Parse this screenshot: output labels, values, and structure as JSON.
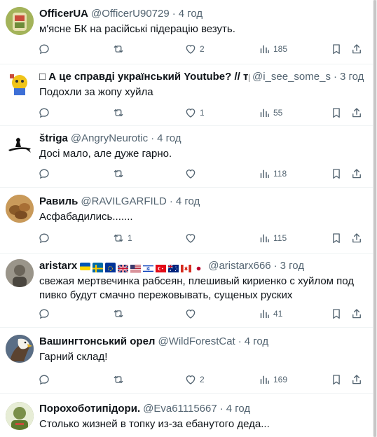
{
  "tweets": [
    {
      "name": "OfficerUA",
      "handle": "@OfficerU90729",
      "time": "4 год",
      "text": "м'ясне БК на расійські підерацію везуть.",
      "reply_count": "",
      "retweet_count": "",
      "like_count": "2",
      "view_count": "185",
      "avatar_color": "#a3b35a"
    },
    {
      "name": "А це справді український Youtube? // тре",
      "handle": "@i_see_some_s",
      "time": "3 год",
      "text": "Подохли за жопу хуйла",
      "reply_count": "",
      "retweet_count": "",
      "like_count": "1",
      "view_count": "55",
      "avatar_color": "#3d6fd6"
    },
    {
      "name": "štriga",
      "handle": "@AngryNeurotic",
      "time": "4 год",
      "text": "Досі мало, але дуже гарно.",
      "reply_count": "",
      "retweet_count": "",
      "like_count": "",
      "view_count": "118",
      "avatar_color": "#ffffff"
    },
    {
      "name": "Равиль",
      "handle": "@RAVILGARFILD",
      "time": "4 год",
      "text": "Асфабадились.......",
      "reply_count": "",
      "retweet_count": "1",
      "like_count": "",
      "view_count": "115",
      "avatar_color": "#b07a3a"
    },
    {
      "name": "aristarx",
      "handle": "@aristarx666",
      "time": "3 год",
      "text": "свежая мертвечинка рабсеян, плешивый кириенко с хуйлом под пивко будут смачно пережовывать, сущеных руских",
      "reply_count": "",
      "retweet_count": "",
      "like_count": "",
      "view_count": "41",
      "avatar_color": "#8f8a7e"
    },
    {
      "name": "Вашингтонський орел",
      "handle": "@WildForestCat",
      "time": "4 год",
      "text": "Гарний склад!",
      "reply_count": "",
      "retweet_count": "",
      "like_count": "2",
      "view_count": "169",
      "avatar_color": "#6d5b45"
    },
    {
      "name": "Порохоботипідори.",
      "handle": "@Eva61115667",
      "time": "4 год",
      "text": "Столько жизней в топку из-за ебанутого деда...",
      "reply_count": "",
      "retweet_count": "",
      "like_count": "",
      "view_count": "",
      "avatar_color": "#7a8f4a"
    }
  ],
  "colors": {
    "text_primary": "#0f1419",
    "text_secondary": "#536471",
    "divider": "#eff3f4"
  },
  "flag_names": [
    "ukraine",
    "sweden",
    "eu",
    "uk",
    "usa",
    "israel",
    "turkey",
    "australia",
    "canada",
    "japan"
  ]
}
